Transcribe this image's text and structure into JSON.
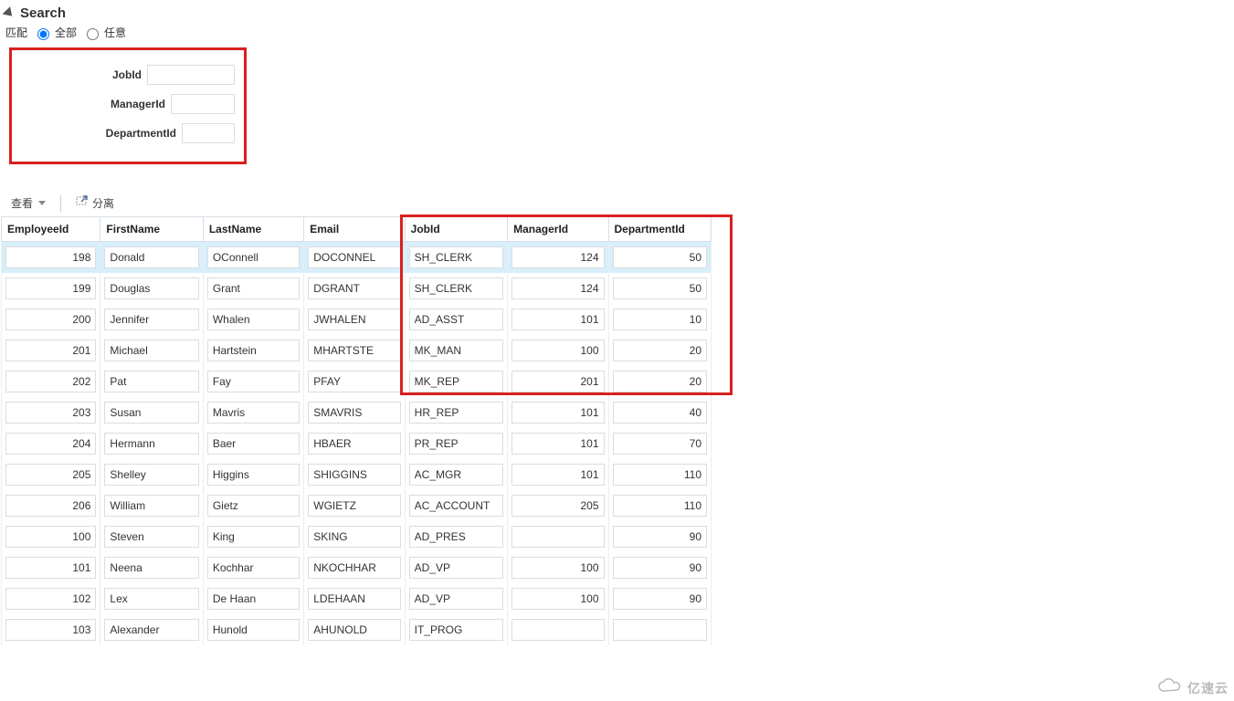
{
  "search": {
    "title": "Search",
    "match_label": "匹配",
    "options": {
      "all": "全部",
      "any": "任意"
    },
    "fields": {
      "job": {
        "label": "JobId",
        "value": ""
      },
      "manager": {
        "label": "ManagerId",
        "value": ""
      },
      "department": {
        "label": "DepartmentId",
        "value": ""
      }
    }
  },
  "toolbar": {
    "view_label": "查看",
    "detach_label": "分离"
  },
  "table": {
    "columns": [
      "EmployeeId",
      "FirstName",
      "LastName",
      "Email",
      "JobId",
      "ManagerId",
      "DepartmentId"
    ],
    "rows": [
      {
        "EmployeeId": "198",
        "FirstName": "Donald",
        "LastName": "OConnell",
        "Email": "DOCONNEL",
        "JobId": "SH_CLERK",
        "ManagerId": "124",
        "DepartmentId": "50"
      },
      {
        "EmployeeId": "199",
        "FirstName": "Douglas",
        "LastName": "Grant",
        "Email": "DGRANT",
        "JobId": "SH_CLERK",
        "ManagerId": "124",
        "DepartmentId": "50"
      },
      {
        "EmployeeId": "200",
        "FirstName": "Jennifer",
        "LastName": "Whalen",
        "Email": "JWHALEN",
        "JobId": "AD_ASST",
        "ManagerId": "101",
        "DepartmentId": "10"
      },
      {
        "EmployeeId": "201",
        "FirstName": "Michael",
        "LastName": "Hartstein",
        "Email": "MHARTSTE",
        "JobId": "MK_MAN",
        "ManagerId": "100",
        "DepartmentId": "20"
      },
      {
        "EmployeeId": "202",
        "FirstName": "Pat",
        "LastName": "Fay",
        "Email": "PFAY",
        "JobId": "MK_REP",
        "ManagerId": "201",
        "DepartmentId": "20"
      },
      {
        "EmployeeId": "203",
        "FirstName": "Susan",
        "LastName": "Mavris",
        "Email": "SMAVRIS",
        "JobId": "HR_REP",
        "ManagerId": "101",
        "DepartmentId": "40"
      },
      {
        "EmployeeId": "204",
        "FirstName": "Hermann",
        "LastName": "Baer",
        "Email": "HBAER",
        "JobId": "PR_REP",
        "ManagerId": "101",
        "DepartmentId": "70"
      },
      {
        "EmployeeId": "205",
        "FirstName": "Shelley",
        "LastName": "Higgins",
        "Email": "SHIGGINS",
        "JobId": "AC_MGR",
        "ManagerId": "101",
        "DepartmentId": "110"
      },
      {
        "EmployeeId": "206",
        "FirstName": "William",
        "LastName": "Gietz",
        "Email": "WGIETZ",
        "JobId": "AC_ACCOUNT",
        "ManagerId": "205",
        "DepartmentId": "110"
      },
      {
        "EmployeeId": "100",
        "FirstName": "Steven",
        "LastName": "King",
        "Email": "SKING",
        "JobId": "AD_PRES",
        "ManagerId": "",
        "DepartmentId": "90"
      },
      {
        "EmployeeId": "101",
        "FirstName": "Neena",
        "LastName": "Kochhar",
        "Email": "NKOCHHAR",
        "JobId": "AD_VP",
        "ManagerId": "100",
        "DepartmentId": "90"
      },
      {
        "EmployeeId": "102",
        "FirstName": "Lex",
        "LastName": "De Haan",
        "Email": "LDEHAAN",
        "JobId": "AD_VP",
        "ManagerId": "100",
        "DepartmentId": "90"
      },
      {
        "EmployeeId": "103",
        "FirstName": "Alexander",
        "LastName": "Hunold",
        "Email": "AHUNOLD",
        "JobId": "IT_PROG",
        "ManagerId": "",
        "DepartmentId": ""
      }
    ],
    "selected_index": 0
  },
  "watermark": "亿速云"
}
